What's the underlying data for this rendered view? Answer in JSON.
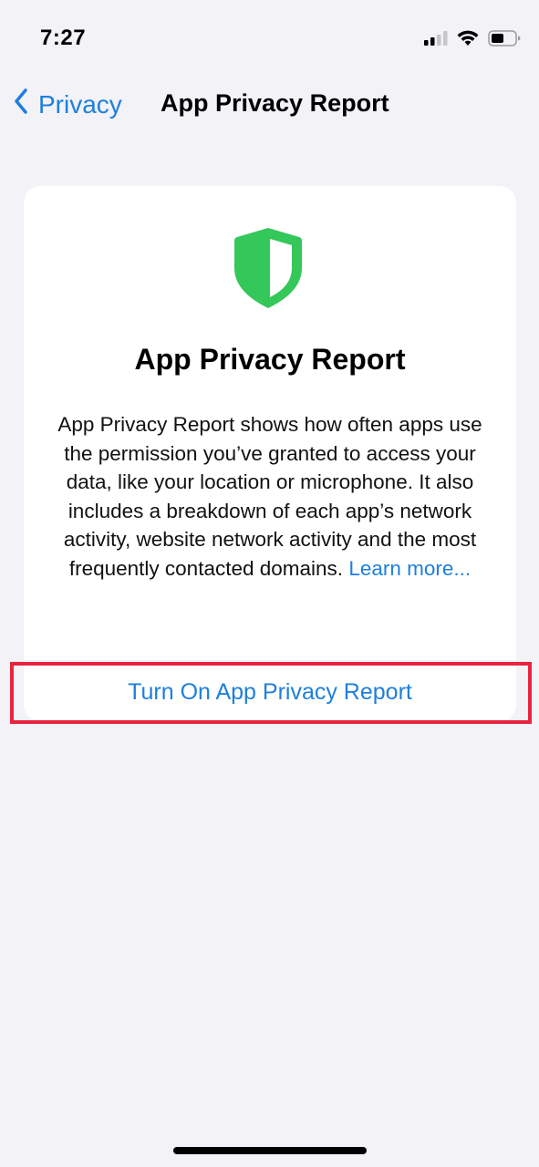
{
  "status_bar": {
    "time": "7:27",
    "icons": [
      "cellular-signal-icon",
      "wifi-icon",
      "battery-icon"
    ],
    "battery_level": 0.5
  },
  "nav": {
    "back_label": "Privacy",
    "title": "App Privacy Report"
  },
  "card": {
    "icon": "shield-icon",
    "title": "App Privacy Report",
    "description": "App Privacy Report shows how often apps use the permission you’ve granted to access your data, like your location or microphone. It also includes a breakdown of each app’s network activity, website network activity and the most frequently contacted domains.",
    "learn_more": "Learn more...",
    "action_label": "Turn On App Privacy Report"
  },
  "colors": {
    "accent": "#1e7fdc",
    "shield_green": "#34c759",
    "highlight": "#e8243f",
    "background": "#f2f2f7"
  }
}
